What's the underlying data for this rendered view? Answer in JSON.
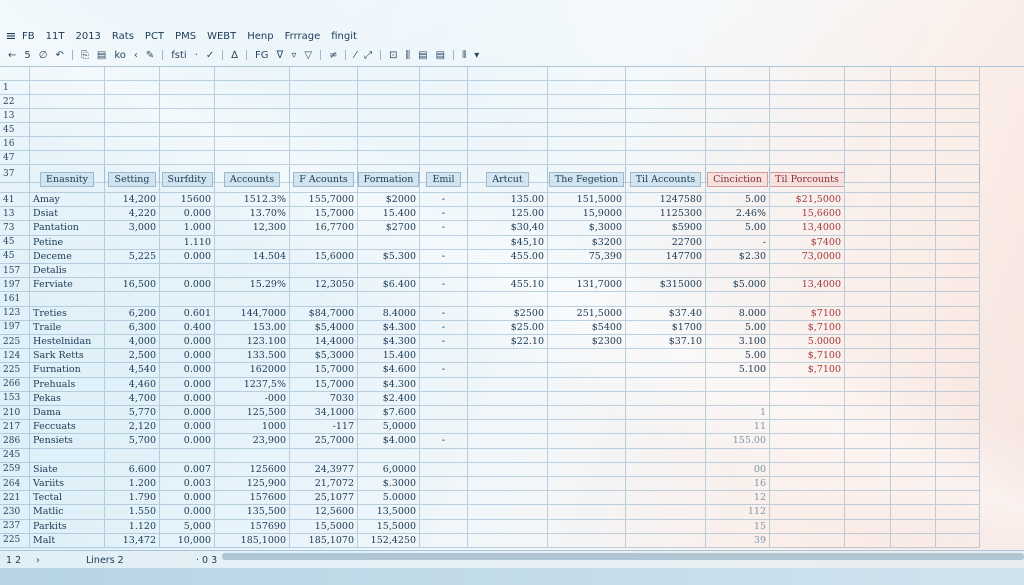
{
  "menu": [
    "FB",
    "11T",
    "2013",
    "Rats",
    "PCT",
    "PMS",
    "WEBT",
    "Henp",
    "Frrrage",
    "fingit"
  ],
  "toolbar": [
    "←",
    "5",
    "∅",
    "↶",
    "|",
    "⎘",
    "▤",
    "ko",
    "‹",
    "✎",
    "|",
    "fsti",
    "·",
    "✓",
    "|",
    "∆",
    "|",
    "FG",
    "ᐁ",
    "▿",
    "▽",
    "|",
    "≠",
    "|",
    "⁄",
    "⤢",
    "|",
    "⊡",
    "⫼",
    "▤",
    "▤",
    "|",
    "⫴",
    "▾"
  ],
  "columns": [
    "Enasnity",
    "Setting",
    "Surfdity",
    "Accounts",
    "F Acounts",
    "Formation",
    "Emil",
    "Artcut",
    "The Fegetion",
    "Til Accounts",
    "Cinciction",
    "Til Porcounts"
  ],
  "top_rows": [
    "1",
    "22",
    "13",
    "45",
    "16",
    "47",
    "37"
  ],
  "rows": [
    {
      "n": "41",
      "v": [
        "Amay",
        "14,200",
        "15600",
        "1512.3%",
        "155,7000",
        "$2000",
        "-",
        "135.00",
        "151,5000",
        "1247580",
        "5.00",
        "$21,5000"
      ]
    },
    {
      "n": "13",
      "v": [
        "Dsiat",
        "4,220",
        "0.000",
        "13.70%",
        "15,7000",
        "15.400",
        "-",
        "125.00",
        "15,9000",
        "1125300",
        "2.46%",
        "15,6600"
      ]
    },
    {
      "n": "73",
      "v": [
        "Pantation",
        "3,000",
        "1.000",
        "12,300",
        "16,7700",
        "$2700",
        "-",
        "$30,40",
        "$,3000",
        "$5900",
        "5.00",
        "13,4000"
      ]
    },
    {
      "n": "45",
      "v": [
        "Petine",
        "",
        "1.110",
        "",
        "",
        "",
        "",
        "$45,10",
        "$3200",
        "22700",
        "-",
        "$7400"
      ]
    },
    {
      "n": "45",
      "v": [
        "Deceme",
        "5,225",
        "0.000",
        "14.504",
        "15,6000",
        "$5.300",
        "-",
        "455.00",
        "75,390",
        "147700",
        "$2.30",
        "73,0000"
      ]
    },
    {
      "n": "157",
      "v": [
        "Detalis",
        "",
        "",
        "",
        "",
        "",
        "",
        "",
        "",
        "",
        "",
        ""
      ]
    },
    {
      "n": "197",
      "v": [
        "Ferviate",
        "16,500",
        "0.000",
        "15.29%",
        "12,3050",
        "$6.400",
        "-",
        "455.10",
        "131,7000",
        "$315000",
        "$5.000",
        "13,4000"
      ]
    },
    {
      "n": "161",
      "v": [
        "",
        "",
        "",
        "",
        "",
        "",
        "",
        "",
        "",
        "",
        "",
        ""
      ]
    },
    {
      "n": "123",
      "v": [
        "Treties",
        "6,200",
        "0.601",
        "144,7000",
        "$84,7000",
        "8.4000",
        "-",
        "$2500",
        "251,5000",
        "$37.40",
        "8.000",
        "$7100"
      ]
    },
    {
      "n": "197",
      "v": [
        "Traile",
        "6,300",
        "0.400",
        "153.00",
        "$5,4000",
        "$4.300",
        "-",
        "$25.00",
        "$5400",
        "$1700",
        "5.00",
        "$,7100"
      ]
    },
    {
      "n": "225",
      "v": [
        "Hestelnidan",
        "4,000",
        "0.000",
        "123.100",
        "14,4000",
        "$4.300",
        "-",
        "$22.10",
        "$2300",
        "$37.10",
        "3.100",
        "5.0000"
      ]
    },
    {
      "n": "124",
      "v": [
        "Sark Retts",
        "2,500",
        "0.000",
        "133.500",
        "$5,3000",
        "15.400",
        "",
        "",
        "",
        "",
        "5.00",
        "$,7100"
      ]
    },
    {
      "n": "225",
      "v": [
        "Furnation",
        "4,540",
        "0.000",
        "162000",
        "15,7000",
        "$4.600",
        "-",
        "",
        "",
        "",
        "5.100",
        "$,7100"
      ]
    },
    {
      "n": "266",
      "v": [
        "Prehuals",
        "4,460",
        "0.000",
        "1237,5%",
        "15,7000",
        "$4.300",
        "",
        "",
        "",
        "",
        "",
        ""
      ]
    },
    {
      "n": "153",
      "v": [
        "Pekas",
        "4,700",
        "0.000",
        "-000",
        "7030",
        "$2.400",
        "",
        "",
        "",
        "",
        "",
        ""
      ]
    },
    {
      "n": "210",
      "v": [
        "Dama",
        "5,770",
        "0.000",
        "125,500",
        "34,1000",
        "$7.600",
        "",
        "",
        "",
        "",
        "1",
        ""
      ]
    },
    {
      "n": "217",
      "v": [
        "Feccuats",
        "2,120",
        "0.000",
        "1000",
        "-117",
        "5,0000",
        "",
        "",
        "",
        "",
        "11",
        ""
      ]
    },
    {
      "n": "286",
      "v": [
        "Pensiets",
        "5,700",
        "0.000",
        "23,900",
        "25,7000",
        "$4.000",
        "-",
        "",
        "",
        "",
        "155.00",
        ""
      ]
    },
    {
      "n": "245",
      "v": [
        "",
        "",
        "",
        "",
        "",
        "",
        "",
        "",
        "",
        "",
        "",
        ""
      ]
    },
    {
      "n": "259",
      "v": [
        "Siate",
        "6.600",
        "0.007",
        "125600",
        "24,3977",
        "6,0000",
        "",
        "",
        "",
        "",
        "00",
        ""
      ]
    },
    {
      "n": "264",
      "v": [
        "Variits",
        "1.200",
        "0.003",
        "125,900",
        "21,7072",
        "$.3000",
        "",
        "",
        "",
        "",
        "16",
        ""
      ]
    },
    {
      "n": "221",
      "v": [
        "Tectal",
        "1.790",
        "0.000",
        "157600",
        "25,1077",
        "5.0000",
        "",
        "",
        "",
        "",
        "12",
        ""
      ]
    },
    {
      "n": "230",
      "v": [
        "Matlic",
        "1.550",
        "0.000",
        "135,500",
        "12,5600",
        "13,5000",
        "",
        "",
        "",
        "",
        "112",
        ""
      ]
    },
    {
      "n": "237",
      "v": [
        "Parkits",
        "1.120",
        "5,000",
        "157690",
        "15,5000",
        "15,5000",
        "",
        "",
        "",
        "",
        "15",
        ""
      ]
    },
    {
      "n": "225",
      "v": [
        "Malt",
        "13,472",
        "10,000",
        "185,1000",
        "185,1070",
        "152,4250",
        "",
        "",
        "",
        "",
        "39",
        ""
      ]
    }
  ],
  "sheetbar": {
    "rowcount": "1 2",
    "nav": "›",
    "tab": "Liners 2",
    "extra": "· 0 3"
  }
}
